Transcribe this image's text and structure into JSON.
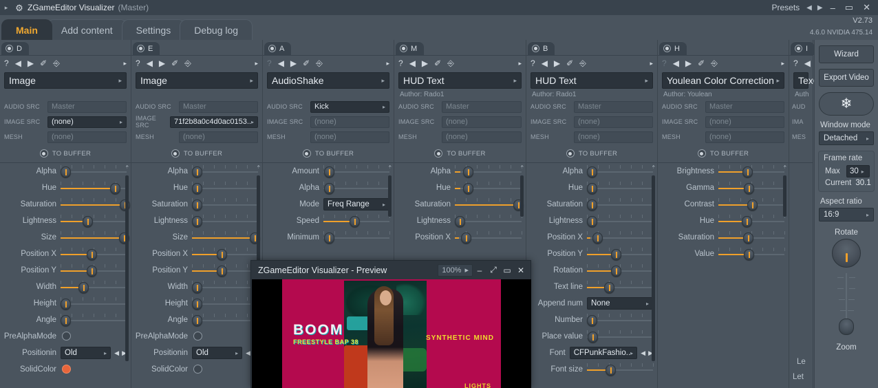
{
  "titlebar": {
    "expand_icon": "▸",
    "gear_icon": "⚙",
    "title": "ZGameEditor Visualizer",
    "subtitle": "(Master)",
    "presets_label": "Presets",
    "prev_icon": "◀",
    "next_icon": "▶",
    "minimize_icon": "–",
    "maximize_icon": "▭",
    "close_icon": "✕"
  },
  "tabs": [
    {
      "label": "Main",
      "active": true
    },
    {
      "label": "Add content",
      "active": false
    },
    {
      "label": "Settings",
      "active": false
    },
    {
      "label": "Debug log",
      "active": false
    }
  ],
  "version": "V2.73",
  "gl_version": "4.6.0 NVIDIA 475.14",
  "icons": {
    "help": "?",
    "prev": "◀",
    "next": "▶",
    "paint": "✐",
    "copy": "⎆",
    "menu": "▸",
    "caret": "▸",
    "scroll_up": "⌃",
    "snowflake": "❄",
    "spin_left": "◀",
    "spin_right": "▶"
  },
  "field_labels": {
    "audio_src": "AUDIO SRC",
    "image_src": "IMAGE SRC",
    "mesh": "MESH",
    "to_buffer": "TO BUFFER"
  },
  "columns": [
    {
      "tab": "D",
      "effect": "Image",
      "author": "",
      "audio_src": "Master",
      "audio_src_active": false,
      "image_src": "(none)",
      "image_src_active": true,
      "mesh": "(none)",
      "params": [
        {
          "label": "Alpha",
          "type": "slider",
          "pos": 7,
          "fill": 0
        },
        {
          "label": "Hue",
          "type": "slider",
          "pos": 82,
          "fill": 82
        },
        {
          "label": "Saturation",
          "type": "slider",
          "pos": 97,
          "fill": 97
        },
        {
          "label": "Lightness",
          "type": "slider",
          "pos": 41,
          "fill": 41
        },
        {
          "label": "Size",
          "type": "slider",
          "pos": 96,
          "fill": 96
        },
        {
          "label": "Position X",
          "type": "slider",
          "pos": 47,
          "fill": 47
        },
        {
          "label": "Position Y",
          "type": "slider",
          "pos": 47,
          "fill": 47
        },
        {
          "label": "Width",
          "type": "slider",
          "pos": 34,
          "fill": 34
        },
        {
          "label": "Height",
          "type": "slider",
          "pos": 7,
          "fill": 0
        },
        {
          "label": "Angle",
          "type": "slider",
          "pos": 7,
          "fill": 0
        },
        {
          "label": "PreAlphaMode",
          "type": "toggle",
          "on": false
        },
        {
          "label": "Positionin",
          "type": "combo",
          "value": "Old",
          "spinner": true
        },
        {
          "label": "SolidColor",
          "type": "toggle",
          "on": true
        }
      ]
    },
    {
      "tab": "E",
      "effect": "Image",
      "author": "",
      "audio_src": "Master",
      "audio_src_active": false,
      "image_src": "71f2b8a0c4d0ac0153..",
      "image_src_active": true,
      "mesh": "(none)",
      "params": [
        {
          "label": "Alpha",
          "type": "slider",
          "pos": 7,
          "fill": 0
        },
        {
          "label": "Hue",
          "type": "slider",
          "pos": 7,
          "fill": 0
        },
        {
          "label": "Saturation",
          "type": "slider",
          "pos": 7,
          "fill": 0
        },
        {
          "label": "Lightness",
          "type": "slider",
          "pos": 7,
          "fill": 0
        },
        {
          "label": "Size",
          "type": "slider",
          "pos": 95,
          "fill": 95
        },
        {
          "label": "Position X",
          "type": "slider",
          "pos": 45,
          "fill": 45
        },
        {
          "label": "Position Y",
          "type": "slider",
          "pos": 45,
          "fill": 45
        },
        {
          "label": "Width",
          "type": "slider",
          "pos": 7,
          "fill": 0
        },
        {
          "label": "Height",
          "type": "slider",
          "pos": 7,
          "fill": 0
        },
        {
          "label": "Angle",
          "type": "slider",
          "pos": 7,
          "fill": 0
        },
        {
          "label": "PreAlphaMode",
          "type": "toggle",
          "on": false
        },
        {
          "label": "Positionin",
          "type": "combo",
          "value": "Old",
          "spinner": true
        },
        {
          "label": "SolidColor",
          "type": "toggle",
          "on": false
        }
      ]
    },
    {
      "tab": "A",
      "effect": "AudioShake",
      "author": "",
      "audio_src": "Kick",
      "audio_src_active": true,
      "image_src": "(none)",
      "image_src_active": false,
      "mesh": "(none)",
      "params": [
        {
          "label": "Amount",
          "type": "slider",
          "pos": 8,
          "fill": 0
        },
        {
          "label": "Alpha",
          "type": "slider",
          "pos": 8,
          "fill": 0
        },
        {
          "label": "Mode",
          "type": "combo",
          "value": "Freq Range",
          "spinner": false
        },
        {
          "label": "Speed",
          "type": "slider",
          "pos": 47,
          "fill": 47
        },
        {
          "label": "Minimum",
          "type": "slider",
          "pos": 8,
          "fill": 0
        }
      ]
    },
    {
      "tab": "M",
      "effect": "HUD Text",
      "author": "Author: Rado1",
      "audio_src": "Master",
      "audio_src_active": false,
      "image_src": "(none)",
      "image_src_active": false,
      "mesh": "(none)",
      "params": [
        {
          "label": "Alpha",
          "type": "slider",
          "pos": 20,
          "fill": 8
        },
        {
          "label": "Hue",
          "type": "slider",
          "pos": 20,
          "fill": 8
        },
        {
          "label": "Saturation",
          "type": "slider",
          "pos": 95,
          "fill": 95
        },
        {
          "label": "Lightness",
          "type": "slider",
          "pos": 7,
          "fill": 0
        },
        {
          "label": "Position X",
          "type": "slider",
          "pos": 17,
          "fill": 6
        }
      ]
    },
    {
      "tab": "B",
      "effect": "HUD Text",
      "author": "Author: Rado1",
      "audio_src": "Master",
      "audio_src_active": false,
      "image_src": "(none)",
      "image_src_active": false,
      "mesh": "(none)",
      "params": [
        {
          "label": "Alpha",
          "type": "slider",
          "pos": 7,
          "fill": 0
        },
        {
          "label": "Hue",
          "type": "slider",
          "pos": 7,
          "fill": 0
        },
        {
          "label": "Saturation",
          "type": "slider",
          "pos": 7,
          "fill": 0
        },
        {
          "label": "Lightness",
          "type": "slider",
          "pos": 7,
          "fill": 0
        },
        {
          "label": "Position X",
          "type": "slider",
          "pos": 16,
          "fill": 5
        },
        {
          "label": "Position Y",
          "type": "slider",
          "pos": 44,
          "fill": 44
        },
        {
          "label": "Rotation",
          "type": "slider",
          "pos": 44,
          "fill": 44
        },
        {
          "label": "Text line",
          "type": "slider",
          "pos": 33,
          "fill": 33
        },
        {
          "label": "Append num",
          "type": "combo",
          "value": "None",
          "spinner": false
        },
        {
          "label": "Number",
          "type": "slider",
          "pos": 7,
          "fill": 0
        },
        {
          "label": "Place value",
          "type": "slider",
          "pos": 8,
          "fill": 0
        },
        {
          "label": "Font",
          "type": "combo",
          "value": "CFPunkFashio..",
          "spinner": true
        },
        {
          "label": "Font size",
          "type": "slider",
          "pos": 35,
          "fill": 35
        }
      ]
    },
    {
      "tab": "H",
      "effect": "Youlean Color Correction",
      "author": "Author: Youlean",
      "audio_src": "Master",
      "audio_src_active": false,
      "image_src": "(none)",
      "image_src_active": false,
      "mesh": "(none)",
      "params": [
        {
          "label": "Brightness",
          "type": "slider",
          "pos": 44,
          "fill": 44
        },
        {
          "label": "Gamma",
          "type": "slider",
          "pos": 46,
          "fill": 46
        },
        {
          "label": "Contrast",
          "type": "slider",
          "pos": 51,
          "fill": 51
        },
        {
          "label": "Hue",
          "type": "slider",
          "pos": 43,
          "fill": 43
        },
        {
          "label": "Saturation",
          "type": "slider",
          "pos": 45,
          "fill": 45
        },
        {
          "label": "Value",
          "type": "slider",
          "pos": 46,
          "fill": 46
        }
      ]
    },
    {
      "tab": "I",
      "effect": "Tex",
      "author": "Auth",
      "audio_src": "AUD",
      "audio_src_active": false,
      "image_src": "IMA",
      "image_src_active": false,
      "mesh": "MES",
      "params": []
    }
  ],
  "sidebar": {
    "wizard_label": "Wizard",
    "export_label": "Export Video",
    "freeze_icon": "❄",
    "window_mode_label": "Window mode",
    "window_mode_value": "Detached",
    "frame_rate_label": "Frame rate",
    "max_label": "Max",
    "max_value": "30",
    "current_label": "Current",
    "current_value": "30.1",
    "aspect_label": "Aspect ratio",
    "aspect_value": "16:9",
    "rotate_label": "Rotate",
    "zoom_label": "Zoom"
  },
  "preview": {
    "title": "ZGameEditor Visualizer - Preview",
    "zoom_value": "100%",
    "zoom_caret": "▸",
    "minimize_icon": "–",
    "fullscreen_icon": "⤢",
    "restore_icon": "▭",
    "close_icon": "✕",
    "content": {
      "boom": "BOOM",
      "subtitle": "FREESTYLE BAP 38",
      "right_text": "SYNTHETIC MIND",
      "bottom_text": "LIGHTS"
    }
  },
  "background_texts": {
    "left_partial_1": "Le",
    "left_partial_2": "Let"
  },
  "colors": {
    "accent": "#f0a02a",
    "tab_active_text": "#f0a830",
    "panel_bg": "#4a545e",
    "field_bg": "#2b333b",
    "preview_magenta": "#b40a4e"
  }
}
